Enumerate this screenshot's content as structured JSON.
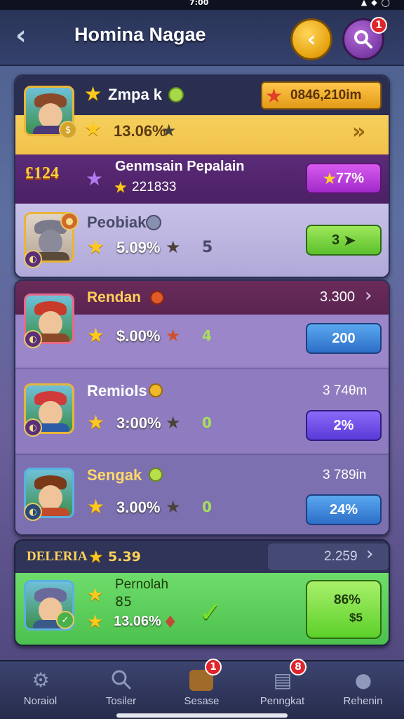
{
  "status": {
    "time": "7:00"
  },
  "header": {
    "title": "Homina Nagae",
    "search_badge": "1"
  },
  "featured": {
    "name": "Zmpa k",
    "currency": "0846,210im",
    "percent": "13.06%"
  },
  "promo": {
    "level": "124",
    "title": "Genmsain Pepalain",
    "score": "221833",
    "pill": "77%"
  },
  "player1": {
    "name": "Peobiak",
    "percent": "5.09%",
    "count": "5",
    "pill": "3"
  },
  "group2_header": {
    "name": "Rendan",
    "value": "3.300"
  },
  "player2": {
    "percent": "$.00%",
    "count": "4",
    "pill": "200"
  },
  "player3": {
    "name": "Remiols",
    "value": "3 74θm",
    "percent": "3:00%",
    "count": "0",
    "pill": "2%"
  },
  "player4": {
    "name": "Sengak",
    "value": "3 789in",
    "percent": "3.00%",
    "count": "0",
    "pill": "24%"
  },
  "section3": {
    "header": "DELERIA",
    "header_score": "5.39",
    "header_value": "2.259",
    "name": "Pernolah",
    "sub": "85",
    "percent": "13.06%",
    "pill_top": "86%",
    "pill_bottom": "$5"
  },
  "tabs": [
    {
      "label": "Noraiol",
      "icon": "gear-icon"
    },
    {
      "label": "Tosiler",
      "icon": "search-icon"
    },
    {
      "label": "Sesase",
      "icon": "chest-icon",
      "badge": "1"
    },
    {
      "label": "Penngkat",
      "icon": "cards-icon",
      "badge": "8"
    },
    {
      "label": "Rehenin",
      "icon": "profile-icon"
    }
  ],
  "colors": {
    "gold": "#ffc81e",
    "purple_header": "#5b2b78",
    "green_row": "#5cd05a"
  }
}
